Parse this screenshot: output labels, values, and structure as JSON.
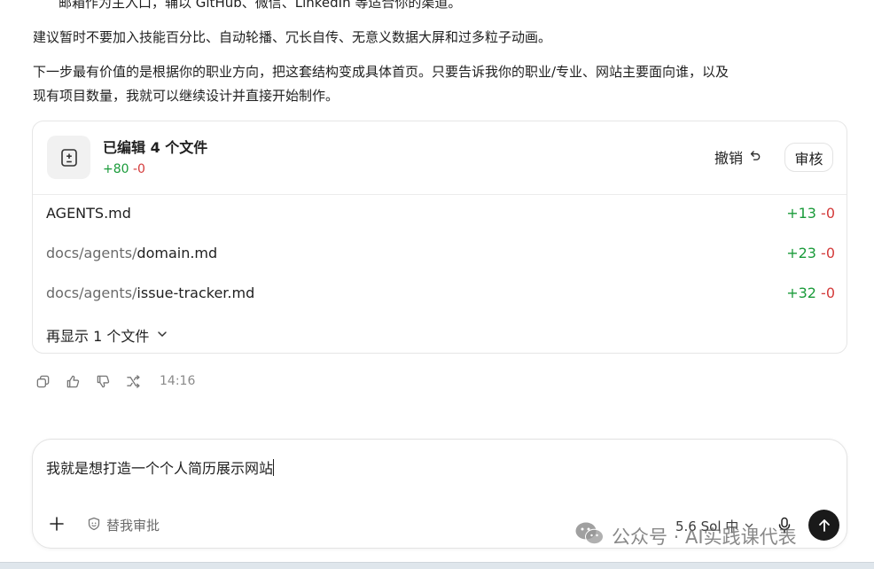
{
  "message": {
    "cut_line": "邮箱作为主入口，辅以 GitHub、微信、LinkedIn 等适合你的渠道。",
    "paragraph_1": "建议暂时不要加入技能百分比、自动轮播、冗长自传、无意义数据大屏和过多粒子动画。",
    "paragraph_2_line_1": "下一步最有价值的是根据你的职业方向，把这套结构变成具体首页。只要告诉我你的职业/专业、网站主要面向谁，以及",
    "paragraph_2_line_2": "现有项目数量，我就可以继续设计并直接开始制作。"
  },
  "edit_card": {
    "title": "已编辑 4 个文件",
    "added": "+80",
    "removed": "-0",
    "undo_label": "撤销",
    "review_label": "审核",
    "files": [
      {
        "dir": "",
        "name": "AGENTS.md",
        "added": "+13",
        "removed": "-0"
      },
      {
        "dir": "docs/agents/",
        "name": "domain.md",
        "added": "+23",
        "removed": "-0"
      },
      {
        "dir": "docs/agents/",
        "name": "issue-tracker.md",
        "added": "+32",
        "removed": "-0"
      }
    ],
    "show_more_label": "再显示 1 个文件"
  },
  "actions": {
    "timestamp": "14:16"
  },
  "composer": {
    "input_value": "我就是想打造一个个人简历展示网站",
    "approve_label": "替我审批",
    "model_label": "5.6 Sol 中"
  },
  "watermark": {
    "text": "公众号 · AI实践课代表"
  },
  "colors": {
    "added": "#1a9b3a",
    "removed": "#d43a3a",
    "send_button": "#1a1a1a"
  }
}
